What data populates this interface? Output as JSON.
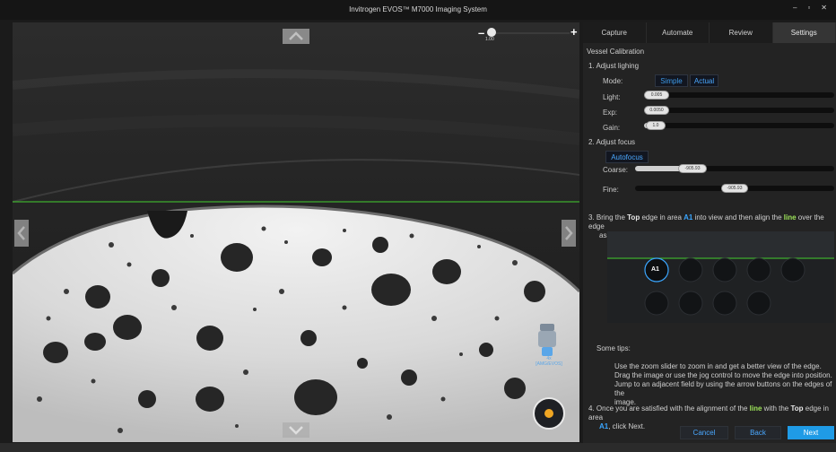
{
  "window": {
    "title": "Invitrogen EVOS™ M7000 Imaging System",
    "controls": [
      "–",
      "▫",
      "✕"
    ]
  },
  "viewer": {
    "zoom": {
      "minus": "–",
      "plus": "+",
      "value": "1.00"
    },
    "objective_label": "4x\n[AMG/EVOS]",
    "line_color": "#3fae2e"
  },
  "tabs": [
    {
      "label": "Capture",
      "active": false
    },
    {
      "label": "Automate",
      "active": false
    },
    {
      "label": "Review",
      "active": false
    },
    {
      "label": "Settings",
      "active": true
    }
  ],
  "panel": {
    "section_title": "Vessel Calibration",
    "step1": {
      "title": "1.  Adjust lighing",
      "mode_label": "Mode:",
      "mode_simple": "Simple",
      "mode_actual": "Actual",
      "light_label": "Light:",
      "light_value": "0.005",
      "light_level": 0.05,
      "exp_label": "Exp:",
      "exp_value": "0.0050",
      "exp_level": 0.05,
      "gain_label": "Gain:",
      "gain_value": "1.0",
      "gain_level": 0.08
    },
    "step2": {
      "title": "2.  Adjust focus",
      "autofocus": "Autofocus",
      "coarse_label": "Coarse:",
      "coarse_value": "-905.93",
      "coarse_level": 0.25,
      "fine_label": "Fine:",
      "fine_value": "-905.93",
      "fine_level": 0.5
    },
    "step3": {
      "prefix": "3.  Bring the ",
      "top": "Top",
      "mid1": " edge in area ",
      "area": "A1",
      "mid2": " into view and then align the ",
      "line": "line",
      "suffix": " over the edge",
      "line2": "as illustrated below.",
      "well_label": "A1"
    },
    "tips": {
      "title": "Some tips:",
      "items": [
        "Use the zoom slider to zoom in and get a better view of the edge.",
        "Drag the image or use the jog control to move the edge into position.",
        "Jump to an adjacent field by using the arrow buttons on the edges of the",
        "image."
      ]
    },
    "step4": {
      "prefix": "4.  Once you are satisfied with the alignment of the ",
      "line": "line",
      "mid": " with the ",
      "top": "Top",
      "suffix": " edge in area",
      "area": "A1",
      "end": ", click Next."
    },
    "buttons": {
      "cancel": "Cancel",
      "back": "Back",
      "next": "Next"
    }
  },
  "colors": {
    "accent": "#1f9be6",
    "highlight_blue": "#3aa6ff",
    "highlight_green": "#9ee65a",
    "jog_dot": "#f0a623"
  }
}
